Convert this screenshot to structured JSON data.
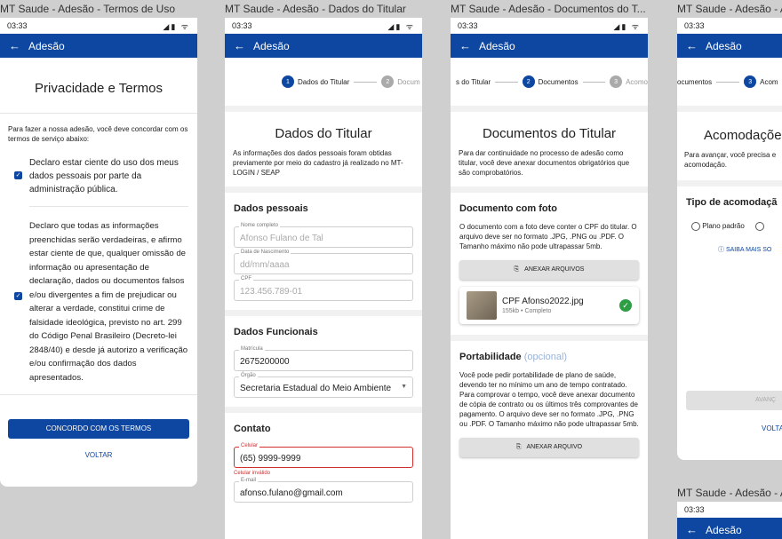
{
  "frames": [
    {
      "title": "MT Saude - Adesão - Termos de Uso"
    },
    {
      "title": "MT Saude - Adesão - Dados do Titular"
    },
    {
      "title": "MT Saude - Adesão - Documentos do T..."
    },
    {
      "title": "MT Saude - Adesão - A"
    },
    {
      "title": "MT Saude - Adesão - A"
    }
  ],
  "status": {
    "time": "03:33",
    "icons": "◢▮ ᯤ"
  },
  "appbar": {
    "back": "←",
    "title": "Adesão"
  },
  "terms": {
    "heading": "Privacidade e Termos",
    "intro": "Para fazer a nossa adesão, você deve concordar com os termos de serviço abaixo:",
    "check1": "Declaro estar ciente do uso dos meus dados pessoais por parte da administração pública.",
    "check2": "Declaro que todas as informações preenchidas serão verdadeiras, e afirmo estar ciente de que, qualquer omissão de informação ou apresentação de declaração, dados ou documentos falsos e/ou divergentes a fim de prejudicar ou alterar a verdade, constitui crime de falsidade ideológica, previsto no art. 299 do Código Penal Brasileiro (Decreto-lei 2848/40) e desde já autorizo a verificação e/ou confirmação dos dados apresentados.",
    "agree": "CONCORDO COM OS TERMOS",
    "back": "VOLTAR"
  },
  "steps": {
    "s1": {
      "num": "1",
      "label": "Dados do Titular"
    },
    "s2": {
      "num": "2",
      "label": "Documentos"
    },
    "s3": {
      "num": "3",
      "label": "Acomodação"
    },
    "s2_cut": "Docum",
    "s1_cut": "s do Titular",
    "s3_cut": "Acomo",
    "s2_cut3": "ocumentos",
    "s3_cut3": "Acom"
  },
  "titular": {
    "heading": "Dados do Titular",
    "intro": "As informações dos dados pessoais foram obtidas previamente por meio do cadastro já realizado no MT-LOGIN / SEAP",
    "pessoais": "Dados pessoais",
    "nome_label": "Nome completo",
    "nome": "Afonso Fulano de Tal",
    "nasc_label": "Data de Nascimento",
    "nasc": "dd/mm/aaaa",
    "cpf_label": "CPF",
    "cpf": "123.456.789-01",
    "funcionais": "Dados Funcionais",
    "mat_label": "Matrícula",
    "mat": "2675200000",
    "orgao_label": "Órgão",
    "orgao": "Secretaria Estadual do Meio Ambiente",
    "contato": "Contato",
    "cel_label": "Celular",
    "cel": "(65) 9999-9999",
    "cel_err": "Celular inválido",
    "email_label": "E-mail",
    "email": "afonso.fulano@gmail.com"
  },
  "docs": {
    "heading": "Documentos do Titular",
    "intro": "Para dar continuidade no processo de adesão como titular, você deve anexar documentos obrigatórios que são comprobatórios.",
    "foto_h": "Documento com foto",
    "foto_p": "O documento com a foto deve conter o CPF do titular. O arquivo deve ser no formato .JPG, .PNG ou .PDF. O Tamanho máximo não pode ultrapassar 5mb.",
    "attach": "ANEXAR ARQUIVOS",
    "file_name": "CPF Afonso2022.jpg",
    "file_size": "155kb",
    "file_sep": "•",
    "file_status": "Completo",
    "port_h": "Portabilidade",
    "port_opt": "(opcional)",
    "port_p": "Você pode pedir portabilidade de plano de saúde, devendo ter no mínimo um ano de tempo contratado. Para comprovar o tempo, você deve anexar documento de cópia de contrato ou os últimos três comprovantes de pagamento. O arquivo deve ser no formato .JPG, .PNG ou .PDF. O Tamanho máximo não pode ultrapassar 5mb.",
    "attach2": "ANEXAR ARQUIVO"
  },
  "acom": {
    "heading": "Acomodaçõe",
    "intro": "Para avançar, você precisa e acomodação.",
    "tipo": "Tipo de acomodaçã",
    "plano": "Plano padrão",
    "saiba": "SAIBA MAIS SO",
    "avancar": "AVANÇ",
    "voltar": "VOLTA"
  },
  "colors": {
    "primary": "#0d47a1",
    "success": "#2e9e44",
    "error": "#d32f2f"
  }
}
